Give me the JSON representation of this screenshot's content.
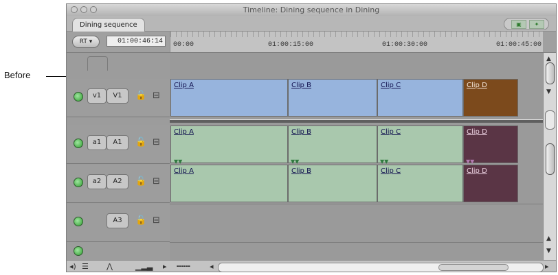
{
  "callout": {
    "before_label": "Before"
  },
  "window": {
    "title": "Timeline: Dining sequence in Dining",
    "tab": "Dining sequence",
    "rt_label": "RT",
    "timecode": "01:00:46:14",
    "ruler_labels": [
      "00:00",
      "01:00:15:00",
      "01:00:30:00",
      "01:00:45:00"
    ]
  },
  "tracks": [
    {
      "source": "v1",
      "dest": "V1"
    },
    {
      "source": "a1",
      "dest": "A1"
    },
    {
      "source": "a2",
      "dest": "A2"
    },
    {
      "source": "",
      "dest": "A3"
    }
  ],
  "clips": {
    "v1": [
      "Clip A",
      "Clip B",
      "Clip C",
      "Clip D"
    ],
    "a1": [
      "Clip A",
      "Clip B",
      "Clip C",
      "Clip D"
    ],
    "a2": [
      "Clip A",
      "Clip B",
      "Clip C",
      "Clip D"
    ]
  },
  "colors": {
    "video_clip": "#97b4dd",
    "audio_clip": "#a9c8ad",
    "video_selected": "#7c4a1c",
    "audio_selected": "#5a3545",
    "playhead": "#e8c21d"
  },
  "icons": {
    "lock": "lock-icon",
    "monitor": "monitor-icon",
    "enable": "track-enable-icon",
    "scroll_up": "arrow-up-icon",
    "scroll_down": "arrow-down-icon"
  }
}
